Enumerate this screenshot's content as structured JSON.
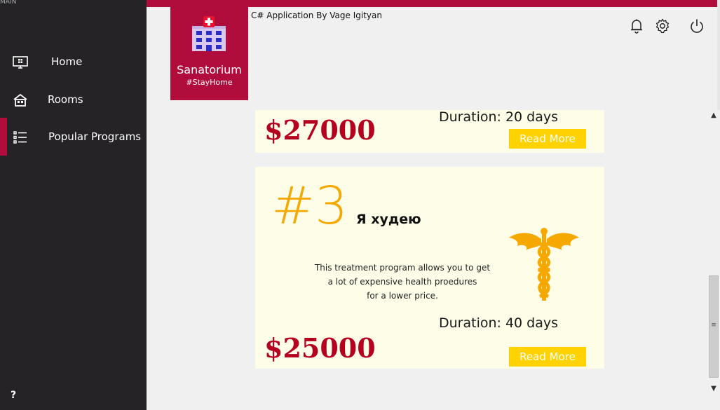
{
  "window": {
    "title_fragment": "MAIN"
  },
  "app": {
    "title": "C# Application By Vage Igityan"
  },
  "logo": {
    "name": "Sanatorium",
    "tagline": "#StayHome"
  },
  "sidebar": {
    "items": [
      {
        "label": "Home",
        "icon": "monitor-icon",
        "active": false
      },
      {
        "label": "Rooms",
        "icon": "house-icon",
        "active": false
      },
      {
        "label": "Popular Programs",
        "icon": "list-icon",
        "active": true
      }
    ],
    "help_label": "?"
  },
  "toolbar": {
    "icons": [
      "bell-icon",
      "gear-icon",
      "power-icon"
    ]
  },
  "programs": [
    {
      "price": "$27000",
      "duration": "Duration: 20 days",
      "read_more": "Read More"
    },
    {
      "number": "#3",
      "name": "Я худею",
      "description_lines": [
        "This treatment program allows you to get",
        "a lot of expensive health proedures",
        "for a lower price."
      ],
      "price": "$25000",
      "duration": "Duration: 40 days",
      "read_more": "Read More",
      "icon": "caduceus-icon"
    }
  ],
  "scrollbar": {
    "up_arrow": "▲",
    "down_arrow": "▼",
    "grip": "≡"
  },
  "colors": {
    "accent": "#b00d3c",
    "sidebar_bg": "#252326",
    "card_bg": "#fefde8",
    "price": "#b5001f",
    "button": "#ffd200",
    "number": "#f5a900"
  }
}
